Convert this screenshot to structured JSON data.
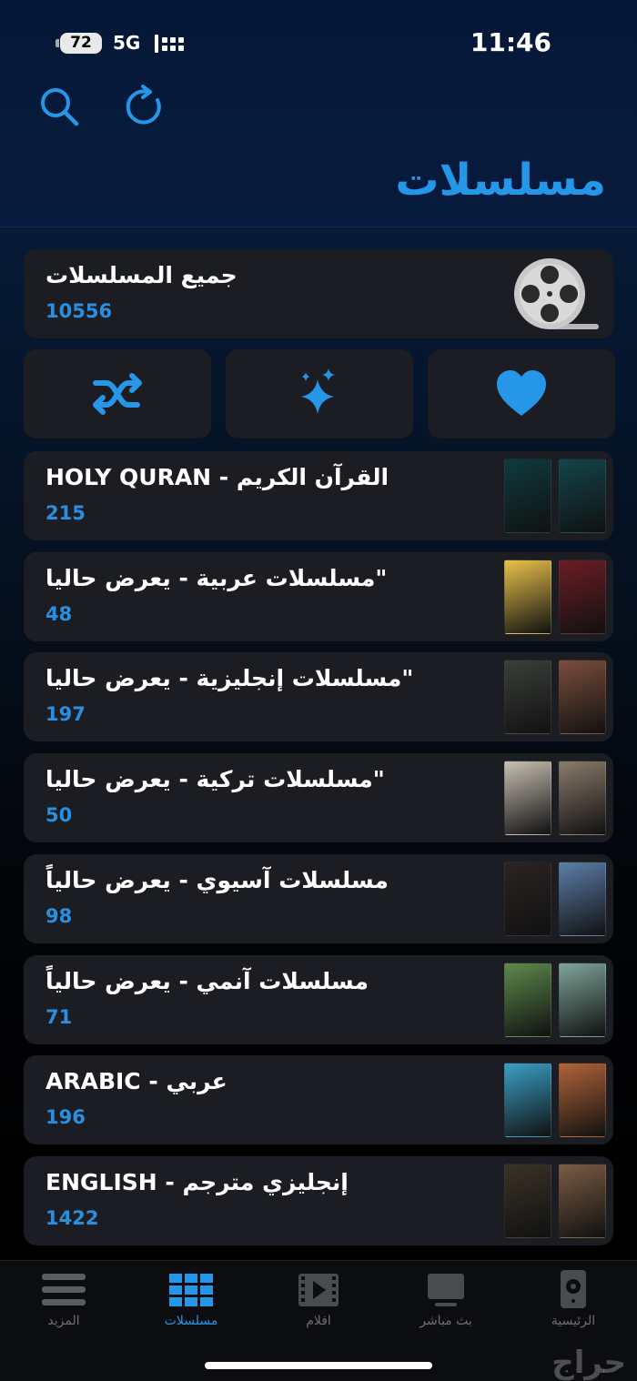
{
  "status_bar": {
    "battery": "72",
    "network": "5G",
    "time": "11:46"
  },
  "header": {
    "title": "مسلسلات",
    "search_icon": "search-icon",
    "refresh_icon": "refresh-icon"
  },
  "all_series": {
    "label": "جميع المسلسلات",
    "count": "10556",
    "icon": "film-reel-icon"
  },
  "actions": [
    {
      "name": "shuffle",
      "icon": "shuffle-icon"
    },
    {
      "name": "new",
      "icon": "sparkles-icon"
    },
    {
      "name": "favorites",
      "icon": "heart-icon"
    }
  ],
  "categories": [
    {
      "label": "HOLY QURAN - القرآن الكريم",
      "count": "215",
      "colors": [
        "#0f3a3e",
        "#12444a"
      ]
    },
    {
      "label": "مسلسلات عربية - يعرض حاليا\"",
      "count": "48",
      "colors": [
        "#e9c24a",
        "#6b1d24"
      ]
    },
    {
      "label": "مسلسلات إنجليزية - يعرض حاليا\"",
      "count": "197",
      "colors": [
        "#3b3f3a",
        "#7b4e3c"
      ]
    },
    {
      "label": "مسلسلات تركية - يعرض حاليا\"",
      "count": "50",
      "colors": [
        "#c8c0b2",
        "#8a7b6c"
      ]
    },
    {
      "label": "مسلسلات آسيوي - يعرض حالياً",
      "count": "98",
      "colors": [
        "#2b2422",
        "#5b7fa8"
      ]
    },
    {
      "label": "مسلسلات آنمي - يعرض حالياً",
      "count": "71",
      "colors": [
        "#5d8a4c",
        "#7fa59a"
      ]
    },
    {
      "label": "ARABIC - عربي",
      "count": "196",
      "colors": [
        "#3aa0c6",
        "#b06438"
      ]
    },
    {
      "label": "ENGLISH - إنجليزي مترجم",
      "count": "1422",
      "colors": [
        "#3a3226",
        "#7a5c44"
      ]
    }
  ],
  "tabbar": [
    {
      "label": "المزيد",
      "icon": "menu-icon",
      "active": false
    },
    {
      "label": "مسلسلات",
      "icon": "grid-icon",
      "active": true
    },
    {
      "label": "افلام",
      "icon": "film-icon",
      "active": false
    },
    {
      "label": "بث مباشر",
      "icon": "tv-icon",
      "active": false
    },
    {
      "label": "الرئيسية",
      "icon": "home-speaker-icon",
      "active": false
    }
  ],
  "watermark": "حراج",
  "colors": {
    "accent": "#2596e8",
    "card": "#1b1d22",
    "count": "#2a8fe0"
  }
}
